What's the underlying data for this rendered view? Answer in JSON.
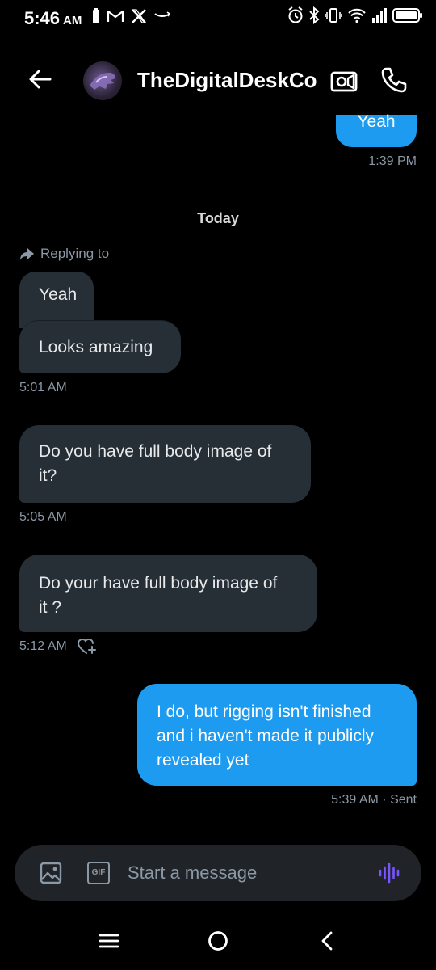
{
  "status_bar": {
    "time": "5:46",
    "ampm": "AM",
    "left_icons": [
      "battery-saver-icon",
      "gmail-icon",
      "x-icon",
      "amazon-icon"
    ],
    "right_icons": [
      "alarm-icon",
      "bluetooth-icon",
      "vibrate-icon",
      "wifi-icon",
      "signal-icon",
      "battery-icon"
    ]
  },
  "header": {
    "contact_name": "TheDigitalDeskCo"
  },
  "messages": {
    "prev_out_text": "Yeah",
    "prev_out_time": "1:39 PM",
    "date_divider": "Today",
    "reply_label": "Replying to",
    "quoted_text": "Yeah",
    "msg1_text": "Looks amazing",
    "msg1_time": "5:01 AM",
    "msg2_line1": "Do you have full body image of",
    "msg2_line2": "it?",
    "msg2_time": "5:05 AM",
    "msg3_line1": "Do your have full body image of",
    "msg3_line2": "it ?",
    "msg3_time": "5:12 AM",
    "msg4_line1": "I do, but rigging isn't finished",
    "msg4_line2": "and i haven't made it publicly",
    "msg4_line3": "revealed yet",
    "msg4_time": "5:39 AM · Sent"
  },
  "composer": {
    "placeholder": "Start a message",
    "gif_label": "GIF"
  },
  "colors": {
    "accent": "#1d9bf0",
    "incoming_bubble": "#262e36",
    "background": "#000000",
    "muted_text": "#8b98a5",
    "voice_icon": "#7856ff"
  }
}
